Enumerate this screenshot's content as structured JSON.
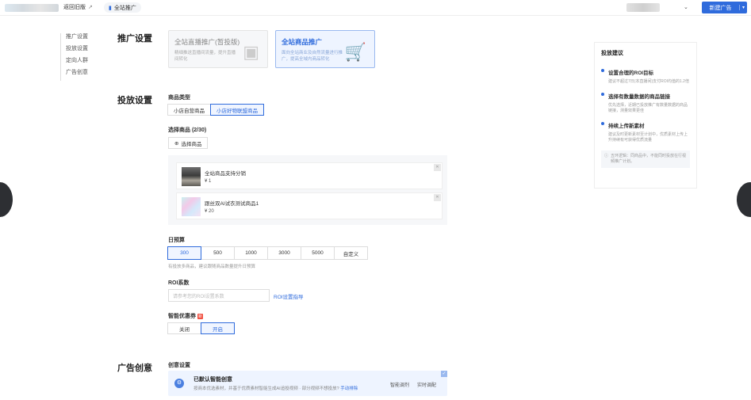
{
  "header": {
    "back_label": "返回旧版",
    "back_icon": "external-link-icon",
    "nav_pill_label": "全站推广",
    "new_ad_label": "新建广告"
  },
  "anchor_nav": [
    "推广设置",
    "投放设置",
    "定向人群",
    "广告创意"
  ],
  "sections": {
    "promo": "推广设置",
    "delivery": "投放设置",
    "creative": "广告创意"
  },
  "promo_cards": [
    {
      "title": "全站直播推广(暂投版)",
      "desc": "精细推送直播间流量，提升直播间转化"
    },
    {
      "title": "全站商品推广",
      "desc": "面向全站商业及自然流量进行推广，提高全域内商品转化"
    }
  ],
  "product_type": {
    "label": "商品类型",
    "options": [
      "小店自营商品",
      "小店好物联盟商品"
    ],
    "selected": 1
  },
  "select_goods": {
    "label": "选择商品 (2/30)",
    "button": "选择商品",
    "items": [
      {
        "name": "全站商品支持分销",
        "price": "¥ 1"
      },
      {
        "name": "跟丝双AI试衣测试商品1",
        "price": "¥ 20"
      }
    ]
  },
  "budget": {
    "label": "日预算",
    "options": [
      "300",
      "500",
      "1000",
      "3000",
      "5000",
      "自定义"
    ],
    "selected": 0,
    "hint": "有投放多商品，建议跟随商品数量提升日预算"
  },
  "roi": {
    "label": "ROI系数",
    "placeholder": "请参考您的ROI设置系数",
    "link": "ROI设置指导"
  },
  "coupon": {
    "label": "智能优惠券",
    "tag": "新",
    "options": [
      "关闭",
      "开启"
    ],
    "selected": 1
  },
  "creative": {
    "label": "创意设置",
    "title": "已默认智能创意",
    "desc": "按商本优选素材，并基于优质素材智能生成AI追投视频 · 部分视频不想投放?",
    "desc_link": "手动排除",
    "modes": [
      "智能调剂",
      "实时调配"
    ]
  },
  "tips": {
    "title": "投放建议",
    "items": [
      {
        "title": "设置合理的ROI目标",
        "desc": "建议不超过7日(本直播间)支付ROI均值的1.2倍"
      },
      {
        "title": "选择有数量数据的商品链接",
        "desc": "优先选择，近期已投放推广有数量数据的商品链接，测量效果更佳"
      },
      {
        "title": "持续上传新素材",
        "desc": "建议及时更新素材至计划中，优质素材上传上升持续有可获得优质流量"
      }
    ],
    "note": "五环逻辑：同商品中，不能同时投放在行视频推广计划。"
  },
  "colors": {
    "accent": "#2f6bdc",
    "new_tag": "#f04a3a"
  }
}
